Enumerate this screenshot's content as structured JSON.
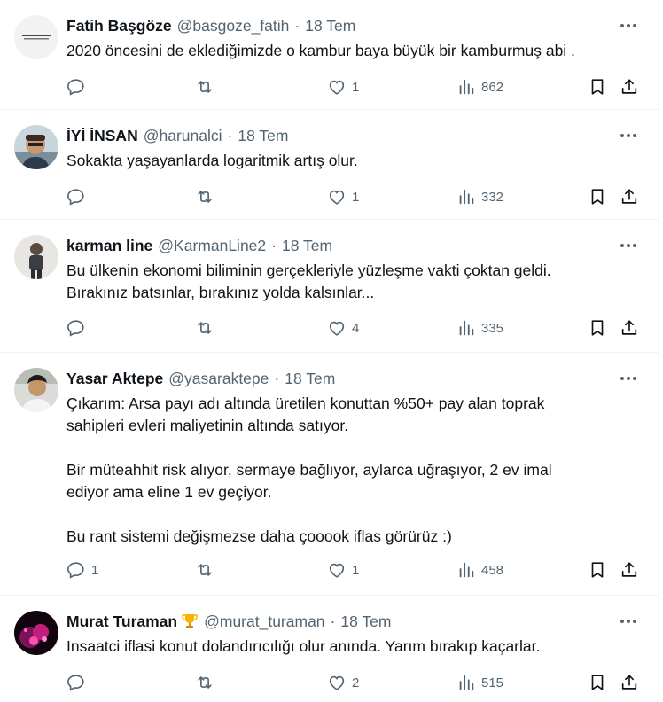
{
  "tweets": [
    {
      "name": "Fatih Başgöze",
      "handle": "@basgoze_fatih",
      "time": "18 Tem",
      "text": "2020 öncesini de eklediğimizde o kambur baya büyük bir kamburmuş abi .",
      "replies": "",
      "likes": "1",
      "views": "862",
      "avatar_icon": "text-logo-avatar"
    },
    {
      "name": "İYİ İNSAN",
      "handle": "@harunalci",
      "time": "18 Tem",
      "text": "Sokakta yaşayanlarda logaritmik artış olur.",
      "replies": "",
      "likes": "1",
      "views": "332",
      "avatar_icon": "person-photo-avatar"
    },
    {
      "name": "karman line",
      "handle": "@KarmanLine2",
      "time": "18 Tem",
      "text": "Bu ülkenin ekonomi biliminin gerçekleriyle yüzleşme vakti çoktan geldi.\nBırakınız batsınlar, bırakınız yolda kalsınlar...",
      "replies": "",
      "likes": "4",
      "views": "335",
      "avatar_icon": "person-photo-avatar"
    },
    {
      "name": "Yasar Aktepe",
      "handle": "@yasaraktepe",
      "time": "18 Tem",
      "text": "Çıkarım: Arsa payı adı altında üretilen konuttan %50+ pay alan toprak\nsahipleri evleri maliyetinin altında satıyor.\n\nBir müteahhit risk alıyor, sermaye bağlıyor, aylarca uğraşıyor, 2 ev imal\nediyor ama eline 1 ev geçiyor.\n\nBu rant sistemi değişmezse daha çooook iflas görürüz :)",
      "replies": "1",
      "likes": "1",
      "views": "458",
      "avatar_icon": "person-photo-avatar"
    },
    {
      "name": "Murat Turaman",
      "handle": "@murat_turaman",
      "time": "18 Tem",
      "text": "Insaatci iflasi konut dolandırıcılığı olur anında. Yarım bırakıp kaçarlar.",
      "replies": "",
      "likes": "2",
      "views": "515",
      "avatar_icon": "pink-abstract-avatar",
      "badge_icon": "trophy-icon"
    }
  ],
  "icons": {
    "reply": "reply-icon",
    "retweet": "retweet-icon",
    "like": "heart-icon",
    "views": "views-chart-icon",
    "bookmark": "bookmark-icon",
    "share": "share-icon",
    "more": "more-dots-icon"
  },
  "colors": {
    "text_primary": "#0f1419",
    "text_secondary": "#536471",
    "divider": "#eff3f4"
  }
}
